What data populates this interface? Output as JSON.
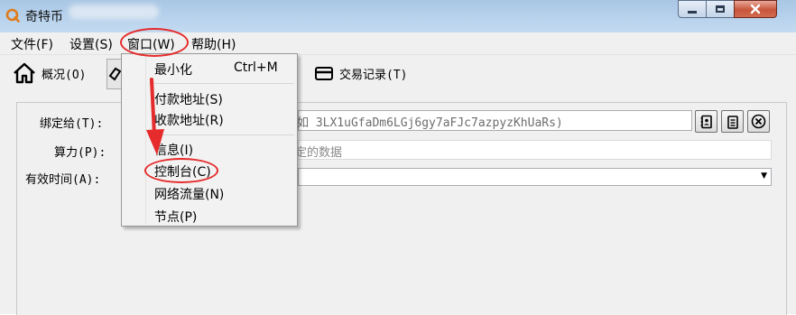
{
  "window": {
    "title": "奇特币"
  },
  "menu": [
    "文件(F)",
    "设置(S)",
    "窗口(W)",
    "帮助(H)"
  ],
  "toolbar": {
    "overview": "概况(O)",
    "transactions": "交易记录(T)"
  },
  "form": {
    "pay_to_label": "绑定给(T):",
    "pay_to_placeholder": "如 3LX1uGfaDm6LGj6gy7aFJc7azpyzKhUaRs)",
    "power_label": "算力(P):",
    "power_placeholder": "定的数据",
    "valid_time_label": "有效时间(A):",
    "valid_time_value": ""
  },
  "window_menu": {
    "minimize": {
      "label": "最小化",
      "shortcut": "Ctrl+M"
    },
    "sending_addresses": "付款地址(S)",
    "receiving_addresses": "收款地址(R)",
    "information": "信息(I)",
    "console": "控制台(C)",
    "network_traffic": "网络流量(N)",
    "peers": "节点(P)"
  },
  "colors": {
    "annotation": "#e52b2b",
    "title_bar": "#b9d3ed",
    "logo": "#e07b19"
  }
}
